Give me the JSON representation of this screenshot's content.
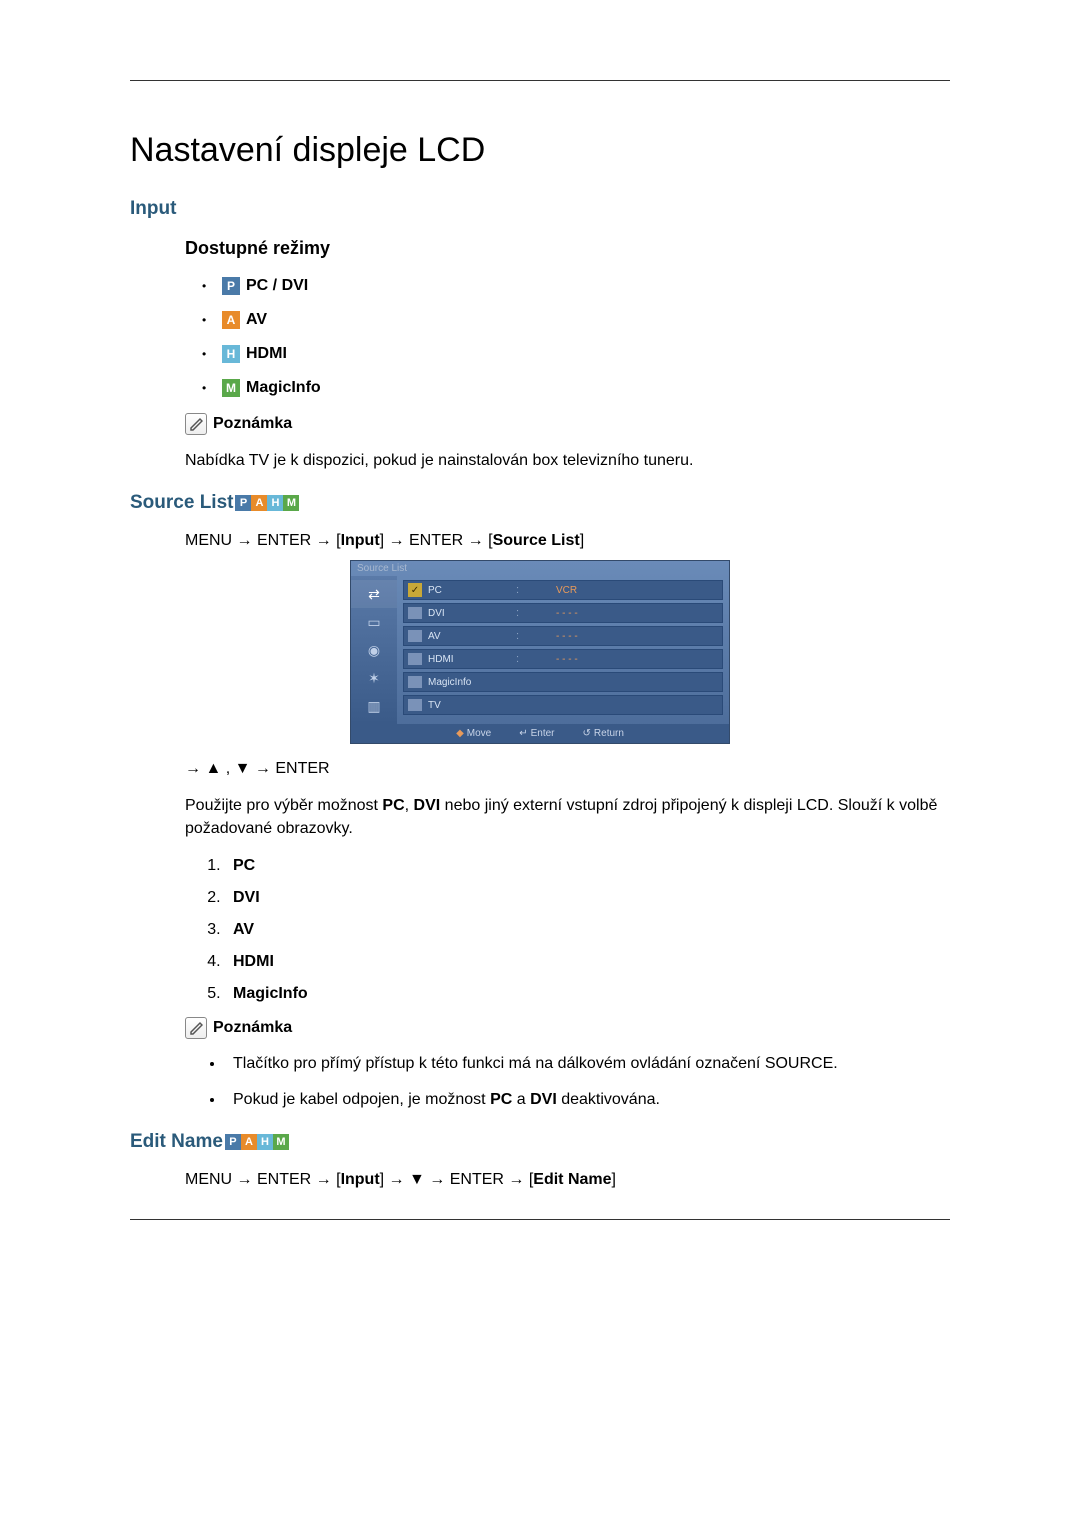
{
  "page_title": "Nastavení displeje LCD",
  "input_section": {
    "heading": "Input",
    "modes_heading": "Dostupné režimy",
    "modes": [
      {
        "letter": "P",
        "label": "PC / DVI"
      },
      {
        "letter": "A",
        "label": "AV"
      },
      {
        "letter": "H",
        "label": "HDMI"
      },
      {
        "letter": "M",
        "label": "MagicInfo"
      }
    ],
    "note_label": "Poznámka",
    "note_text": "Nabídka TV je k dispozici, pokud je nainstalován box televizního tuneru."
  },
  "source_list": {
    "heading": "Source List",
    "heading_icons": [
      "P",
      "A",
      "H",
      "M"
    ],
    "menu_path": "MENU → ENTER → [Input] → ENTER → [Source List]",
    "menu_path_parts": {
      "p1": "MENU → ENTER → [",
      "b1": "Input",
      "p2": "] → ENTER → [",
      "b2": "Source List",
      "p3": "]"
    },
    "osd": {
      "title": "Source List",
      "rows": [
        {
          "label": "PC",
          "value": "VCR",
          "checked": true
        },
        {
          "label": "DVI",
          "value": "- - - -",
          "checked": false
        },
        {
          "label": "AV",
          "value": "- - - -",
          "checked": false
        },
        {
          "label": "HDMI",
          "value": "- - - -",
          "checked": false
        },
        {
          "label": "MagicInfo",
          "value": "",
          "checked": false
        },
        {
          "label": "TV",
          "value": "",
          "checked": false
        }
      ],
      "footer": {
        "move": "Move",
        "enter": "Enter",
        "return": "Return"
      }
    },
    "arrow_nav": "→ ▲ , ▼ → ENTER",
    "description_parts": {
      "p1": "Použijte pro výběr možnost ",
      "b1": "PC",
      "p2": ", ",
      "b2": "DVI",
      "p3": " nebo jiný externí vstupní zdroj připojený k displeji LCD. Slouží k volbě požadované obrazovky."
    },
    "numbered": [
      "PC",
      "DVI",
      "AV",
      "HDMI",
      "MagicInfo"
    ],
    "note_label": "Poznámka",
    "bullets": {
      "b1p1": "Tlačítko pro přímý přístup k této funkci má na dálkovém ovládání označení SOURCE.",
      "b2p1": "Pokud je kabel odpojen, je možnost ",
      "b2b1": "PC",
      "b2p2": " a ",
      "b2b2": "DVI",
      "b2p3": " deaktivována."
    }
  },
  "edit_name": {
    "heading": "Edit Name",
    "heading_icons": [
      "P",
      "A",
      "H",
      "M"
    ],
    "menu_path_parts": {
      "p1": "MENU → ENTER → [",
      "b1": "Input",
      "p2": "] → ▼ → ENTER → [",
      "b2": "Edit Name",
      "p3": "]"
    }
  }
}
